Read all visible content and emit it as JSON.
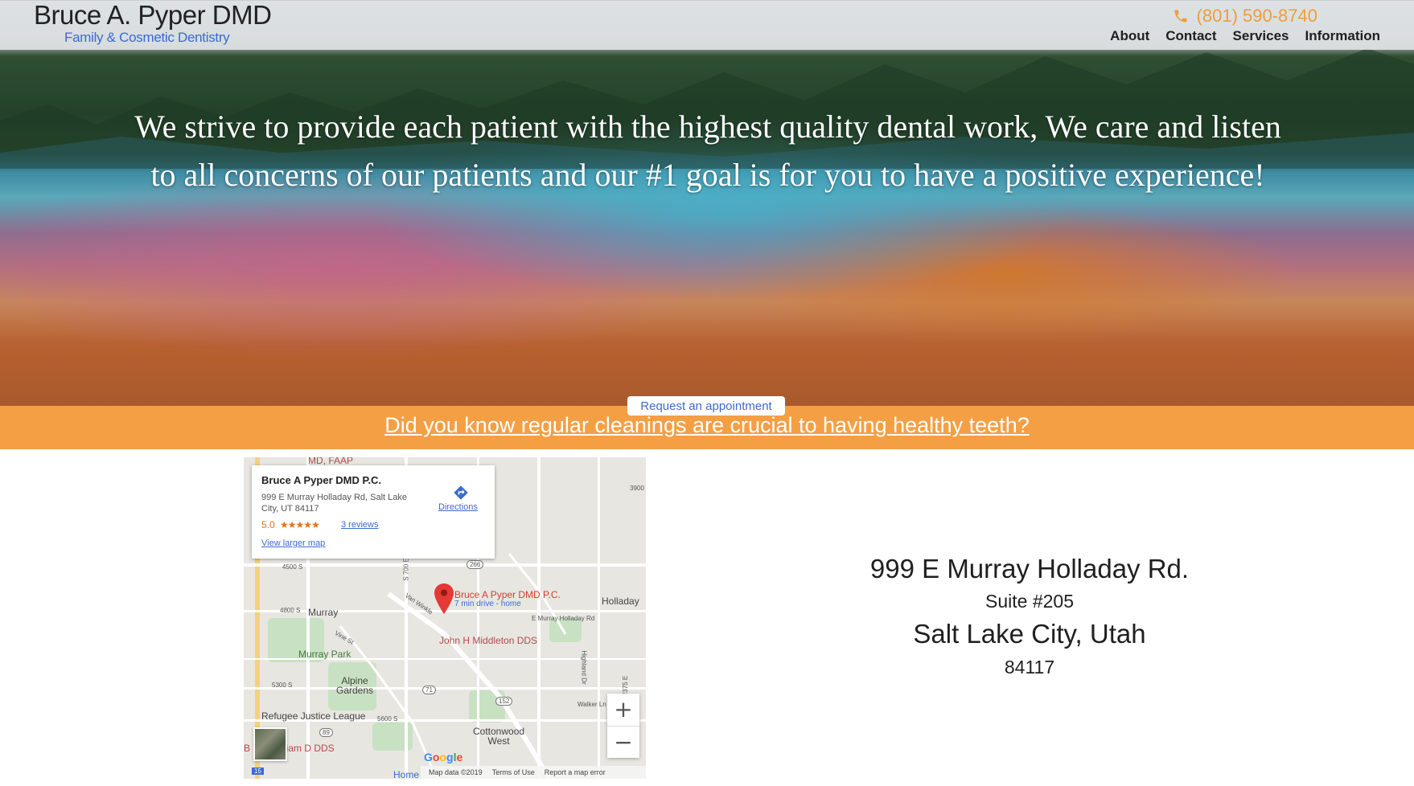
{
  "header": {
    "brand_name": "Bruce A. Pyper DMD",
    "tagline": "Family & Cosmetic Dentistry",
    "phone": "(801) 590-8740",
    "phone_icon": "phone-icon",
    "nav": [
      "About",
      "Contact",
      "Services",
      "Information"
    ]
  },
  "hero": {
    "text": "We strive to provide each patient with the highest quality dental work, We care and listen to all concerns of our patients and our #1 goal is for you to have a positive experience!",
    "request_button": "Request an appointment"
  },
  "banner": {
    "link_text": "Did you know regular cleanings are crucial to having healthy teeth?"
  },
  "map": {
    "card": {
      "title": "Bruce A Pyper DMD P.C.",
      "address": "999 E Murray Holladay Rd, Salt Lake City, UT 84117",
      "rating": "5.0",
      "stars": "★★★★★",
      "reviews": "3 reviews",
      "larger_map": "View larger map",
      "directions": "Directions"
    },
    "pin_label": "Bruce A Pyper DMD P.C.",
    "pin_sub": "7 min drive - home",
    "labels": {
      "top_poi": "MD, FAAP",
      "murray": "Murray",
      "holladay": "Holladay",
      "murray_park": "Murray Park",
      "alpine_gardens": "Alpine\nGardens",
      "refugee": "Refugee Justice League",
      "middleton": "John H Middleton DDS",
      "cottonwood": "Cottonwood\nWest",
      "william": "liam D DDS",
      "william_prefix": "B",
      "home": "Home",
      "van_winkle": "Van Winkle",
      "murray_holladay_rd": "E Murray Holladay Rd",
      "s4500": "4500 S",
      "s4800": "4800 S",
      "s5300": "5300 S",
      "s5600": "5600 S",
      "vine": "Vine St",
      "walker": "Walker Ln",
      "highland": "Highland Dr",
      "e3900": "3900",
      "r266": "266",
      "r71": "71",
      "r152": "152",
      "r89": "89",
      "r15": "15",
      "s700e": "S 700 E",
      "e2375": "2375 E"
    },
    "zoom_in": "+",
    "zoom_out": "−",
    "google": "Google",
    "footer": [
      "Map data ©2019",
      "Terms of Use",
      "Report a map error"
    ]
  },
  "address": {
    "street": "999 E Murray Holladay Rd.",
    "suite": "Suite #205",
    "city": "Salt Lake City, Utah",
    "zip": "84117"
  },
  "colors": {
    "accent_orange": "#f59f45",
    "phone_orange": "#ef9d3b",
    "link_blue": "#3b6bd0",
    "pin_red": "#d23f31"
  }
}
